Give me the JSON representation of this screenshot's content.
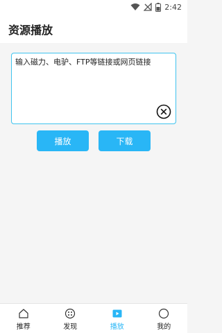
{
  "status": {
    "time": "2:42"
  },
  "header": {
    "title": "资源播放"
  },
  "input": {
    "placeholder": "输入磁力、电驴、FTP等链接或网页链接"
  },
  "buttons": {
    "play_label": "播放",
    "download_label": "下载"
  },
  "tabs": [
    {
      "label": "推荐",
      "icon": "home-icon",
      "active": false
    },
    {
      "label": "发现",
      "icon": "discover-icon",
      "active": false
    },
    {
      "label": "播放",
      "icon": "play-icon",
      "active": true
    },
    {
      "label": "我的",
      "icon": "profile-icon",
      "active": false
    }
  ],
  "colors": {
    "accent": "#29b6f6",
    "border": "#3ec3ee"
  }
}
